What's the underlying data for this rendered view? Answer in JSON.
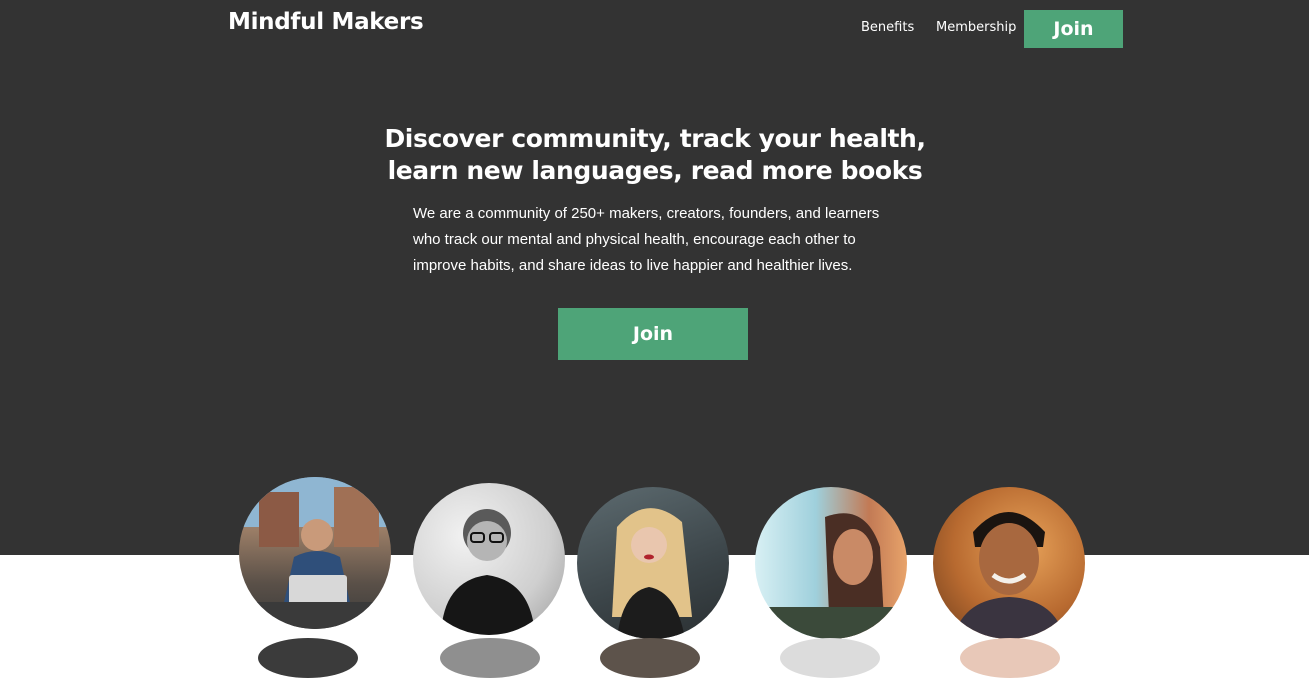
{
  "header": {
    "brand": "Mindful Makers",
    "nav": {
      "benefits": "Benefits",
      "membership": "Membership",
      "join": "Join"
    }
  },
  "hero": {
    "headline_line1": "Discover community, track your health,",
    "headline_line2": "learn new languages, read more books",
    "intro": "We are a community of 250+ makers, creators, founders, and learners who track our mental and physical health, encourage each other to improve habits, and share ideas to live happier and healthier lives.",
    "cta": "Join"
  },
  "colors": {
    "hero_background": "#333333",
    "accent_green": "#4ea478",
    "text": "#ffffff"
  },
  "members": {
    "avatars": [
      "member-photo-1",
      "member-photo-2",
      "member-photo-3",
      "member-photo-4",
      "member-photo-5"
    ]
  }
}
